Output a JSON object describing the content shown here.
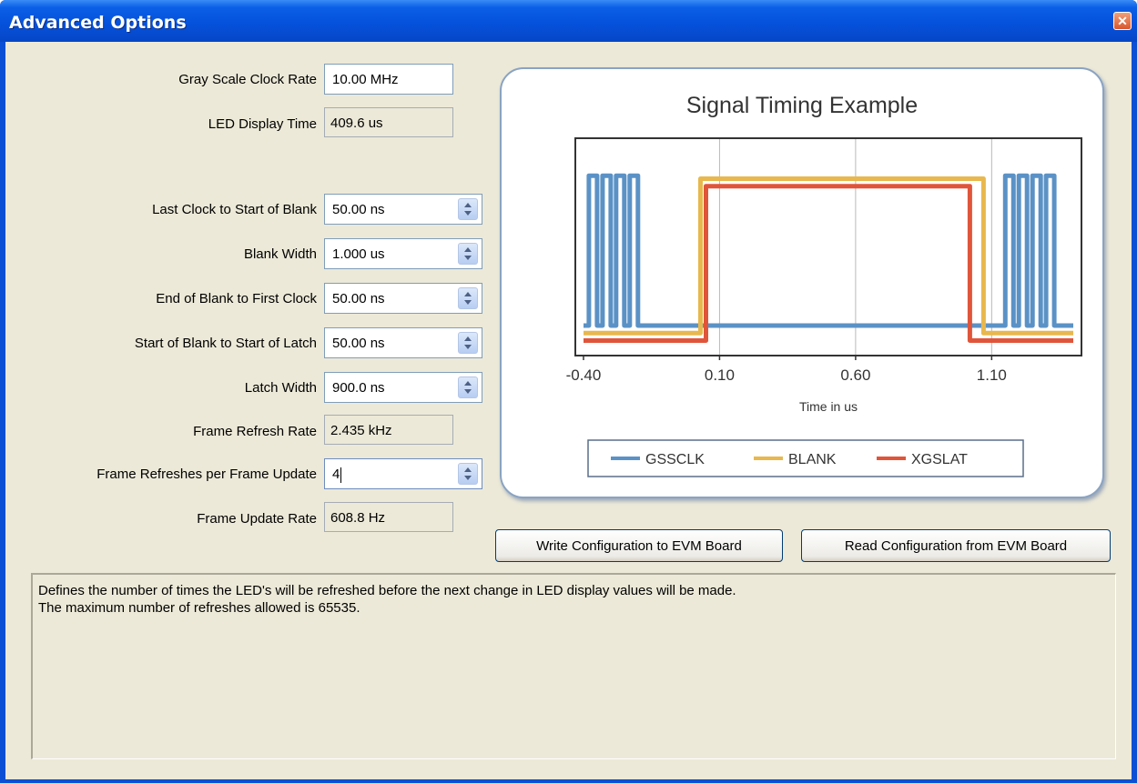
{
  "window": {
    "title": "Advanced Options",
    "close_icon": "close-icon"
  },
  "fields": {
    "gray_scale_clock_rate": {
      "label": "Gray Scale Clock Rate",
      "value": "10.00 MHz"
    },
    "led_display_time": {
      "label": "LED Display Time",
      "value": "409.6 us"
    },
    "last_clock_to_start_of_blank": {
      "label": "Last Clock to  Start of Blank",
      "value": "50.00 ns"
    },
    "blank_width": {
      "label": "Blank Width",
      "value": "1.000 us"
    },
    "end_of_blank_to_first_clock": {
      "label": "End of Blank to First Clock",
      "value": "50.00 ns"
    },
    "start_of_blank_to_start_of_latch": {
      "label": "Start of Blank to Start of Latch",
      "value": "50.00 ns"
    },
    "latch_width": {
      "label": "Latch Width",
      "value": "900.0 ns"
    },
    "frame_refresh_rate": {
      "label": "Frame Refresh Rate",
      "value": "2.435 kHz"
    },
    "frame_refreshes_per_frame_update": {
      "label": "Frame Refreshes per Frame Update",
      "value": "4"
    },
    "frame_update_rate": {
      "label": "Frame Update Rate",
      "value": "608.8 Hz"
    }
  },
  "buttons": {
    "write": "Write Configuration to EVM Board",
    "read": "Read Configuration from EVM Board"
  },
  "description": {
    "line1": "Defines the number of times the LED's will be refreshed before the next change in LED display values will be made.",
    "line2": "The maximum number of refreshes allowed is 65535."
  },
  "chart_data": {
    "type": "line",
    "title": "Signal Timing Example",
    "xlabel": "Time in us",
    "ylabel": "",
    "x_ticks": [
      "-0.40",
      "0.10",
      "0.60",
      "1.10"
    ],
    "xlim": [
      -0.43,
      1.43
    ],
    "ylim": [
      -0.2,
      1.25
    ],
    "grid": true,
    "legend_position": "bottom",
    "series": [
      {
        "name": "GSSCLK",
        "color": "#5b92c6",
        "points": [
          [
            -0.4,
            0
          ],
          [
            -0.38,
            0
          ],
          [
            -0.38,
            1
          ],
          [
            -0.35,
            1
          ],
          [
            -0.35,
            0
          ],
          [
            -0.33,
            0
          ],
          [
            -0.33,
            1
          ],
          [
            -0.3,
            1
          ],
          [
            -0.3,
            0
          ],
          [
            -0.28,
            0
          ],
          [
            -0.28,
            1
          ],
          [
            -0.25,
            1
          ],
          [
            -0.25,
            0
          ],
          [
            -0.23,
            0
          ],
          [
            -0.23,
            1
          ],
          [
            -0.2,
            1
          ],
          [
            -0.2,
            0
          ],
          [
            1.15,
            0
          ],
          [
            1.15,
            1
          ],
          [
            1.18,
            1
          ],
          [
            1.18,
            0
          ],
          [
            1.2,
            0
          ],
          [
            1.2,
            1
          ],
          [
            1.23,
            1
          ],
          [
            1.23,
            0
          ],
          [
            1.25,
            0
          ],
          [
            1.25,
            1
          ],
          [
            1.28,
            1
          ],
          [
            1.28,
            0
          ],
          [
            1.3,
            0
          ],
          [
            1.3,
            1
          ],
          [
            1.33,
            1
          ],
          [
            1.33,
            0
          ],
          [
            1.4,
            0
          ]
        ]
      },
      {
        "name": "BLANK",
        "color": "#e8b84e",
        "points": [
          [
            -0.4,
            -0.05
          ],
          [
            0.03,
            -0.05
          ],
          [
            0.03,
            0.98
          ],
          [
            1.07,
            0.98
          ],
          [
            1.07,
            -0.05
          ],
          [
            1.4,
            -0.05
          ]
        ]
      },
      {
        "name": "XGSLAT",
        "color": "#e0553a",
        "points": [
          [
            -0.4,
            -0.1
          ],
          [
            0.05,
            -0.1
          ],
          [
            0.05,
            0.93
          ],
          [
            1.02,
            0.93
          ],
          [
            1.02,
            -0.1
          ],
          [
            1.4,
            -0.1
          ]
        ]
      }
    ]
  }
}
